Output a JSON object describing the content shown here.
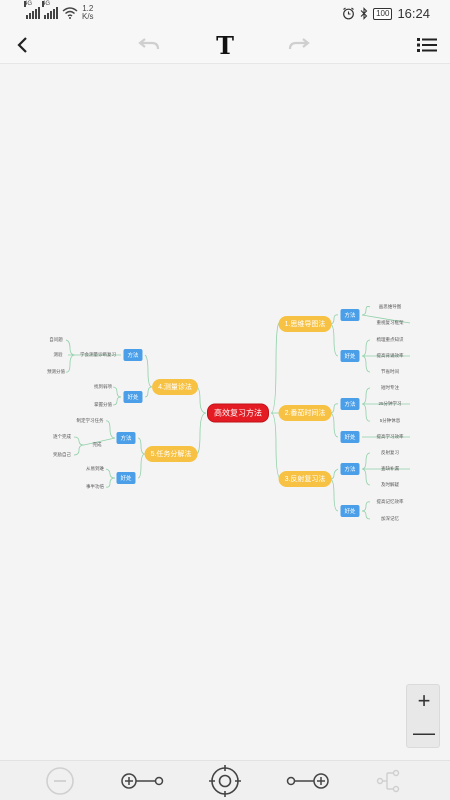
{
  "status": {
    "network": "4G",
    "speed_value": "1.2",
    "speed_unit": "K/s",
    "battery": "100",
    "time": "16:24"
  },
  "toolbar": {
    "back_icon": "chevron-left-icon",
    "undo_icon": "undo-icon",
    "text_label": "T",
    "redo_icon": "redo-icon",
    "menu_icon": "list-menu-icon"
  },
  "mindmap": {
    "root": "高效复习方法",
    "b1": {
      "label": "1.思维导图法",
      "s1": "方法",
      "s1_leaves": [
        "画思维导图",
        "重视复习框架"
      ],
      "s2": "好处",
      "s2_leaves": [
        "梳理重点知识",
        "提高背诵效率",
        "节省时间"
      ]
    },
    "b2": {
      "label": "2.番茄时间法",
      "s1": "方法",
      "s1_leaves": [
        "短时专注",
        "25分钟学习",
        "5分钟休息"
      ],
      "s2": "好处",
      "s2_leaves": [
        "提高学习效率"
      ]
    },
    "b3": {
      "label": "3.反射复习法",
      "s1": "方法",
      "s1_leaves": [
        "反射复习",
        "查缺补漏",
        "及时解疑"
      ],
      "s2": "好处",
      "s2_leaves": [
        "提高记忆效率",
        "加深记忆"
      ]
    },
    "b4": {
      "label": "4.测量诊法",
      "s1": "方法",
      "s1_leaves": [
        "自问题",
        "测验",
        "预测分值"
      ],
      "s1_extra": "学会测量诊断复习",
      "s2": "好处",
      "s2_leaves": [
        "找到弱项",
        "掌握分值"
      ]
    },
    "b5": {
      "label": "5.任务分解法",
      "s1": "方法",
      "s1_leaves": [
        "制定学习任务",
        "逐个完成",
        "奖励自己"
      ],
      "s1_extra": "完成",
      "s2": "好处",
      "s2_leaves": [
        "从易到难",
        "事半功倍"
      ]
    }
  },
  "zoom": {
    "in_label": "+",
    "out_label": "—"
  },
  "bottombar": {
    "icons": [
      "remove-node-icon",
      "add-sibling-icon",
      "locate-center-icon",
      "add-child-icon",
      "structure-icon"
    ]
  }
}
